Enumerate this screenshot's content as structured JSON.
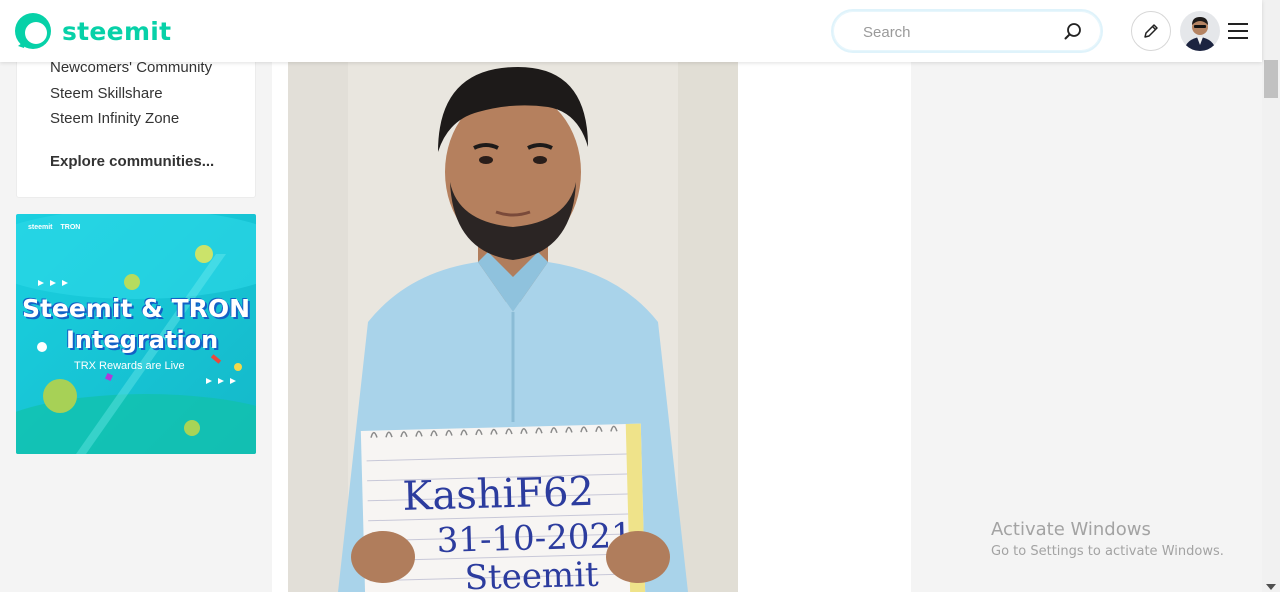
{
  "header": {
    "brand": "steemit",
    "search_placeholder": "Search"
  },
  "sidebar": {
    "communities": [
      {
        "label": "Newcomers' Community"
      },
      {
        "label": "Steem Skillshare"
      },
      {
        "label": "Steem Infinity Zone"
      }
    ],
    "explore_label": "Explore communities..."
  },
  "banner": {
    "brand_left": "steemit",
    "brand_right": "TRON",
    "title_line1": "Steemit & TRON",
    "title_line2": "Integration",
    "subtitle": "TRX Rewards are Live"
  },
  "post": {
    "sign_line1": "KashiF62",
    "sign_line2": "31-10-2021",
    "sign_line3": "Steemit"
  },
  "watermark": {
    "title": "Activate Windows",
    "subtitle": "Go to Settings to activate Windows."
  },
  "colors": {
    "brand": "#07d1a8",
    "banner_bg": "#19c7d8",
    "page_bg": "#f4f4f4"
  }
}
